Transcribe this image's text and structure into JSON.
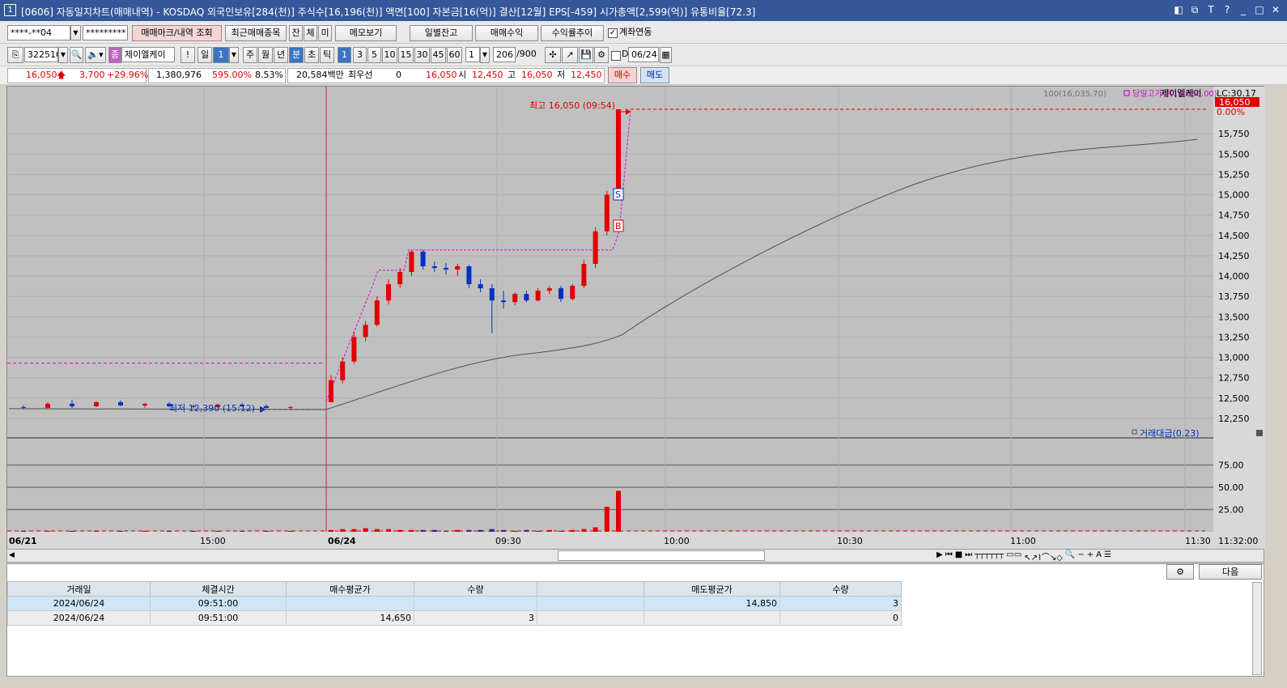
{
  "window": {
    "number": "1",
    "title": "[0606] 자동일지차트(매매내역) - KOSDAQ 외국인보유[284(천)] 주식수[16,196(천)] 액면[100] 자본금[16(억)] 결산[12월] EPS[-459] 시가총액[2,599(억)] 유통비율[72.3]",
    "controls": [
      "◧",
      "⧉",
      "T",
      "?",
      "_",
      "□",
      "✕"
    ]
  },
  "toolbar1": {
    "account": "****-**04",
    "password": "*********",
    "trade_mark_button": "매매마크/내역 조회",
    "recent_items_button": "최근매매종목",
    "tab_jan": "잔",
    "tab_che": "체",
    "tab_mi": "미",
    "memo_button": "메모보기",
    "daily_balance_button": "일별잔고",
    "trade_profit_button": "매매수익",
    "return_trend_button": "수익률추이",
    "account_link_label": "계좌연동"
  },
  "toolbar2": {
    "code": "322510",
    "stock_name": "제이엘케이",
    "warn": "!",
    "period_day": "일",
    "period_value": "1",
    "week": "주",
    "month": "월",
    "year": "년",
    "minute": "분",
    "second": "초",
    "tick": "틱",
    "intervals": [
      "1",
      "3",
      "5",
      "10",
      "15",
      "30",
      "45",
      "60"
    ],
    "interval_input": "1",
    "count": "206",
    "count_total": "/900",
    "d_label": "D",
    "date": "06/24"
  },
  "quote": {
    "price": "16,050",
    "up_arrow": "🡅",
    "change": "3,700",
    "change_pct": "+29.96%",
    "volume": "1,380,976",
    "vol_ratio": "595.00%",
    "turnover": "8.53%",
    "amount": "20,584백만",
    "priority": "최우선",
    "priority_value": "0",
    "ask": "16,050",
    "open_label": "시",
    "open": "12,450",
    "high_label": "고",
    "high": "16,050",
    "low_label": "저",
    "low": "12,450",
    "buy_button": "매수",
    "sell_button": "매도"
  },
  "chart_data": {
    "type": "candlestick",
    "legend": {
      "ma": "100(16,035.70)",
      "high_line": "당일고가선(16,050.00)",
      "name": "제이엘케이",
      "lc": "LC:30.17"
    },
    "price_tag": "16,050",
    "pct_tag": "0.00%",
    "annotations": {
      "high": "최고 16,050 (09:54)",
      "low": "최저 12,390 (15:12)",
      "sell_marker": "S",
      "buy_marker": "B"
    },
    "y_ticks": [
      "16,050",
      "15,750",
      "15,500",
      "15,250",
      "15,000",
      "14,750",
      "14,500",
      "14,250",
      "14,000",
      "13,750",
      "13,500",
      "13,250",
      "13,000",
      "12,750",
      "12,500",
      "12,250"
    ],
    "y_range": [
      12150,
      16150
    ],
    "volume_legend": "거래대금(0.23)",
    "volume_ticks": [
      "75.00",
      "50.00",
      "25.00"
    ],
    "volume_range": [
      0,
      100
    ],
    "x_labels": [
      "06/21",
      "15:00",
      "06/24",
      "09:30",
      "10:00",
      "10:30",
      "11:00",
      "11:30",
      "11:32:00"
    ],
    "prev_close": 12930,
    "low_line": 12360,
    "day_high": 16050,
    "candles": [
      [
        12390,
        12410,
        12360,
        12380
      ],
      [
        12380,
        12450,
        12370,
        12430
      ],
      [
        12430,
        12480,
        12380,
        12400
      ],
      [
        12400,
        12460,
        12390,
        12450
      ],
      [
        12450,
        12470,
        12400,
        12410
      ],
      [
        12410,
        12440,
        12380,
        12430
      ],
      [
        12430,
        12450,
        12390,
        12400
      ],
      [
        12400,
        12420,
        12380,
        12390
      ],
      [
        12390,
        12430,
        12380,
        12420
      ],
      [
        12420,
        12440,
        12390,
        12400
      ],
      [
        12400,
        12420,
        12370,
        12380
      ],
      [
        12380,
        12400,
        12360,
        12390
      ],
      [
        12450,
        12780,
        12450,
        12720
      ],
      [
        12720,
        13000,
        12680,
        12950
      ],
      [
        12950,
        13320,
        12920,
        13250
      ],
      [
        13250,
        13450,
        13200,
        13400
      ],
      [
        13400,
        13750,
        13380,
        13700
      ],
      [
        13700,
        13960,
        13650,
        13900
      ],
      [
        13900,
        14100,
        13850,
        14050
      ],
      [
        14050,
        14320,
        14000,
        14300
      ],
      [
        14300,
        14320,
        14080,
        14120
      ],
      [
        14120,
        14180,
        14050,
        14100
      ],
      [
        14100,
        14160,
        14020,
        14080
      ],
      [
        14080,
        14150,
        14000,
        14120
      ],
      [
        14120,
        14140,
        13850,
        13900
      ],
      [
        13900,
        13960,
        13800,
        13850
      ],
      [
        13850,
        13900,
        13300,
        13700
      ],
      [
        13700,
        13820,
        13600,
        13680
      ],
      [
        13680,
        13800,
        13640,
        13780
      ],
      [
        13780,
        13820,
        13680,
        13700
      ],
      [
        13700,
        13850,
        13690,
        13820
      ],
      [
        13820,
        13880,
        13780,
        13850
      ],
      [
        13850,
        13880,
        13680,
        13720
      ],
      [
        13720,
        13900,
        13700,
        13880
      ],
      [
        13880,
        14200,
        13850,
        14150
      ],
      [
        14150,
        14600,
        14100,
        14550
      ],
      [
        14550,
        15050,
        14500,
        15000
      ],
      [
        15000,
        16050,
        14980,
        16050
      ]
    ],
    "volumes": [
      1,
      1,
      1,
      1,
      1,
      1,
      1,
      1,
      1,
      1,
      1,
      1,
      2,
      3,
      3,
      4,
      3,
      3,
      2,
      2,
      2,
      2,
      1,
      2,
      2,
      2,
      3,
      2,
      1,
      2,
      1,
      2,
      1,
      2,
      3,
      5,
      28,
      46
    ]
  },
  "lower_panel": {
    "settings_icon": "gear-icon",
    "next_button": "다음",
    "columns": [
      "거래일",
      "체결시간",
      "매수평균가",
      "수량",
      "",
      "매도평균가",
      "수량"
    ],
    "rows": [
      [
        "2024/06/24",
        "09:51:00",
        "",
        "",
        "",
        "14,850",
        "3"
      ],
      [
        "2024/06/24",
        "09:51:00",
        "14,650",
        "3",
        "",
        "",
        "0"
      ]
    ]
  }
}
